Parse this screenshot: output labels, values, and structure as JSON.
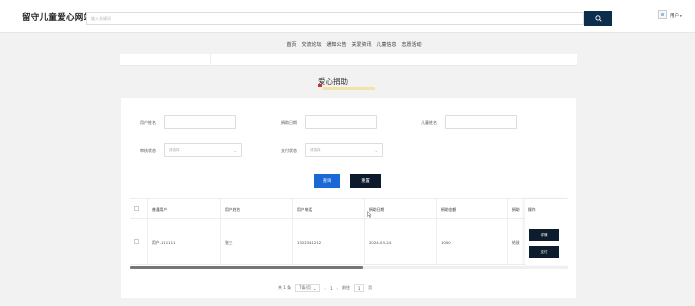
{
  "header": {
    "site_title": "留守儿童爱心网站",
    "search_placeholder": "输入关键词",
    "user_label": "用户"
  },
  "nav": {
    "items": [
      "首页",
      "交流论坛",
      "通知公告",
      "关爱资讯",
      "儿童信息",
      "志愿活动"
    ]
  },
  "page": {
    "heading": "爱心捐助"
  },
  "filters": {
    "user_name_label": "用户姓名",
    "donate_date_label": "捐助日期",
    "child_name_label": "儿童姓名",
    "review_status_label": "审核状态",
    "review_status_placeholder": "请选择",
    "pay_status_label": "支付状态",
    "pay_status_placeholder": "请选择",
    "query_button": "查询",
    "reset_button": "重置"
  },
  "table": {
    "headers": [
      "普通用户",
      "用户姓名",
      "用户电话",
      "捐助日期",
      "捐助金额",
      "捐助"
    ],
    "op_header": "操作",
    "rows": [
      {
        "user": "用户-111111",
        "name": "张三",
        "phone": "1322341212",
        "date": "2024-03-24",
        "amount": "1000",
        "partial": "给孩"
      }
    ],
    "row_actions": [
      "详情",
      "支付"
    ]
  },
  "pagination": {
    "total_text": "共 1 条",
    "page_size": "7条/页",
    "prev": "‹",
    "current_page": "1",
    "next": "›",
    "goto_label": "前往",
    "goto_value": "1",
    "page_suffix": "页"
  },
  "colors": {
    "search_button": "#0d2d4d",
    "query_button": "#1a67d6",
    "reset_button": "#0c1b2b",
    "heading_flag": "#c0392b",
    "heading_highlight": "#f4e3a8"
  }
}
